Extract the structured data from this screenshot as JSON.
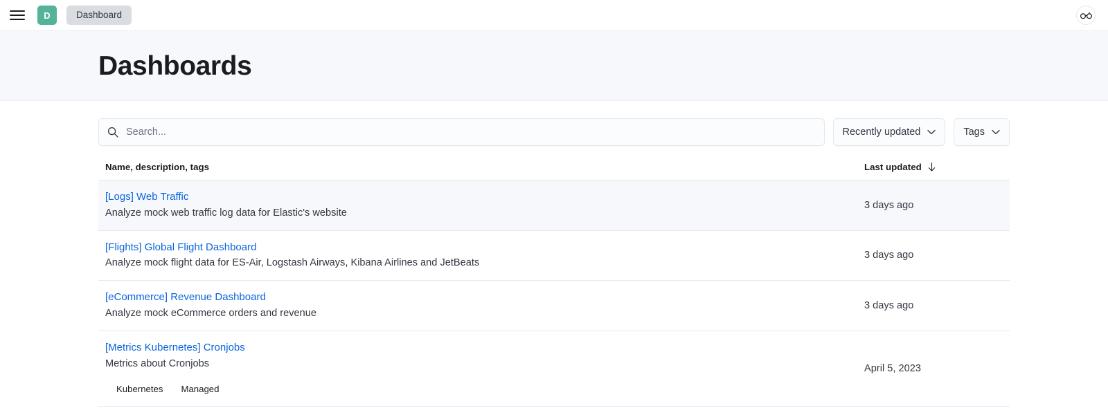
{
  "topbar": {
    "menu_icon": "hamburger-menu-icon",
    "app_badge_letter": "D",
    "breadcrumb_label": "Dashboard",
    "right_icon": "glasses-icon"
  },
  "page": {
    "title": "Dashboards"
  },
  "search": {
    "icon": "search-icon",
    "placeholder": "Search...",
    "value": ""
  },
  "filters": [
    {
      "label": "Recently updated",
      "icon": "chevron-down-icon"
    },
    {
      "label": "Tags",
      "icon": "chevron-down-icon"
    }
  ],
  "table": {
    "columns": {
      "name": "Name, description, tags",
      "updated": "Last updated",
      "sort_icon": "arrow-down-icon"
    },
    "rows": [
      {
        "title": "[Logs] Web Traffic",
        "description": "Analyze mock web traffic log data for Elastic's website",
        "tags": [],
        "updated": "3 days ago",
        "highlighted": true
      },
      {
        "title": "[Flights] Global Flight Dashboard",
        "description": "Analyze mock flight data for ES-Air, Logstash Airways, Kibana Airlines and JetBeats",
        "tags": [],
        "updated": "3 days ago",
        "highlighted": false
      },
      {
        "title": "[eCommerce] Revenue Dashboard",
        "description": "Analyze mock eCommerce orders and revenue",
        "tags": [],
        "updated": "3 days ago",
        "highlighted": false
      },
      {
        "title": "[Metrics Kubernetes] Cronjobs",
        "description": "Metrics about Cronjobs",
        "tags": [
          "Kubernetes",
          "Managed"
        ],
        "updated": "April 5, 2023",
        "highlighted": false
      }
    ]
  },
  "colors": {
    "accent_link": "#0b64dd",
    "badge_green": "#54b399",
    "header_bg": "#f7f8fc",
    "row_highlight": "#f6f8fc"
  }
}
